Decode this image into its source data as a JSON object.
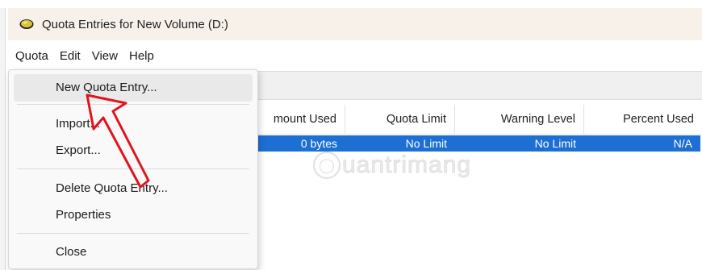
{
  "window": {
    "title": "Quota Entries for New Volume (D:)",
    "icon": "drive-icon"
  },
  "menubar": {
    "items": [
      "Quota",
      "Edit",
      "View",
      "Help"
    ]
  },
  "dropdown": {
    "items": [
      {
        "label": "New Quota Entry...",
        "highlighted": true
      },
      {
        "label": "Import..."
      },
      {
        "label": "Export..."
      },
      {
        "label": "Delete Quota Entry..."
      },
      {
        "label": "Properties"
      },
      {
        "label": "Close"
      }
    ]
  },
  "table": {
    "columns": [
      "mount Used",
      "Quota Limit",
      "Warning Level",
      "Percent Used"
    ],
    "rows": [
      {
        "amount_used": "0 bytes",
        "quota_limit": "No Limit",
        "warning_level": "No Limit",
        "percent_used": "N/A",
        "selected": true
      }
    ]
  },
  "watermark": {
    "text": "uantrimang"
  },
  "colors": {
    "selection": "#1e6fd3",
    "titlebar": "#f7f1ea",
    "annotation_arrow": "#e0141e"
  }
}
